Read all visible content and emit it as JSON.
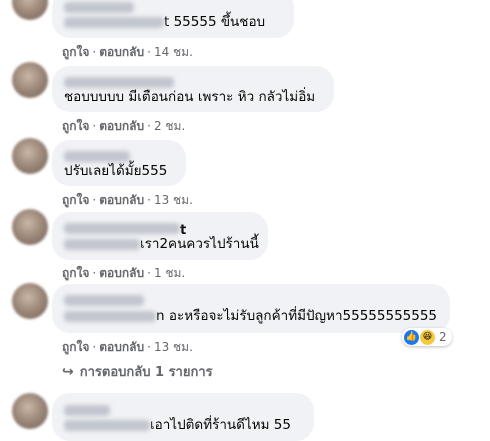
{
  "comments": [
    {
      "text": "55555 ขึ้นชอบ",
      "text_suffix_prefix": "t",
      "like_label": "ถูกใจ",
      "reply_label": "ตอบกลับ",
      "time": "14 ชม."
    },
    {
      "text": "ชอบบบบบ มีเตือนก่อน เพราะ หิว กลัวไม่อิ่ม",
      "like_label": "ถูกใจ",
      "reply_label": "ตอบกลับ",
      "time": "2 ชม."
    },
    {
      "text": "ปรับเลยได้มั้ย555",
      "like_label": "ถูกใจ",
      "reply_label": "ตอบกลับ",
      "time": "13 ชม."
    },
    {
      "name_tail": "t",
      "text": "เรา2คนควรไปร้านนี้",
      "like_label": "ถูกใจ",
      "reply_label": "ตอบกลับ",
      "time": "1 ชม."
    },
    {
      "text": "n อะหรือจะไม่รับลูกค้าที่มีปัญหา55555555555",
      "like_label": "ถูกใจ",
      "reply_label": "ตอบกลับ",
      "time": "13 ชม.",
      "reaction_count": "2"
    },
    {
      "text": "เอาไปติดที่ร้านดีไหม 55",
      "time": ""
    }
  ],
  "replies_link": "การตอบกลับ 1 รายการ",
  "dot": "·",
  "icons": {
    "reply_arrow": "reply-arrow-icon",
    "like": "like-icon",
    "haha": "haha-icon"
  },
  "colors": {
    "bubble": "#f0f2f5",
    "meta": "#65676b",
    "like_blue": "#1877f2"
  }
}
